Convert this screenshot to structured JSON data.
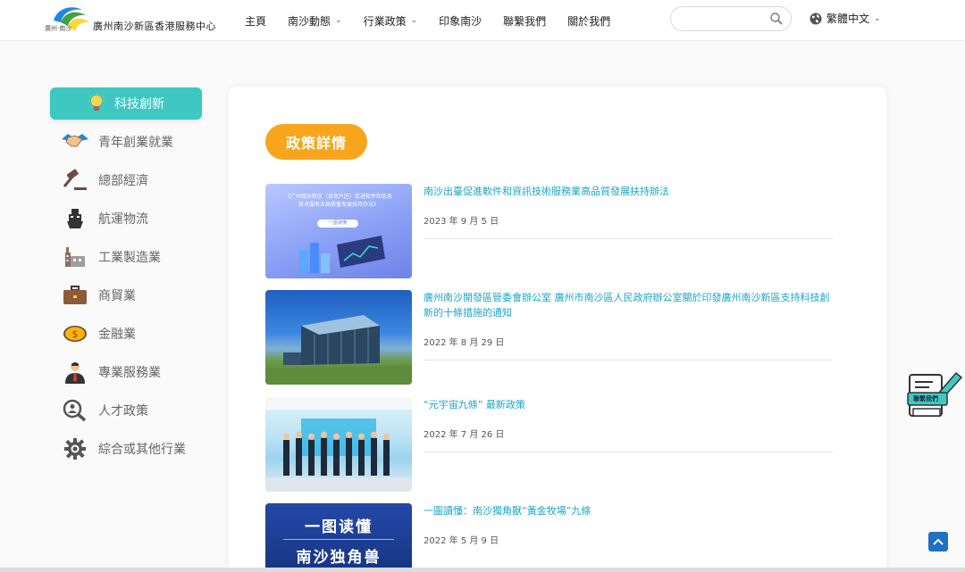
{
  "header": {
    "logo_small": "廣州·南沙",
    "logo_text": "廣州南沙新區香港服務中心",
    "nav": [
      {
        "label": "主頁",
        "has_dropdown": false
      },
      {
        "label": "南沙動態",
        "has_dropdown": true
      },
      {
        "label": "行業政策",
        "has_dropdown": true
      },
      {
        "label": "印象南沙",
        "has_dropdown": false
      },
      {
        "label": "聯繫我們",
        "has_dropdown": false
      },
      {
        "label": "關於我們",
        "has_dropdown": false
      }
    ],
    "search": {
      "value": "",
      "placeholder": ""
    },
    "language": "繁體中文"
  },
  "sidebar": {
    "items": [
      {
        "label": "科技創新",
        "icon": "lightbulb-icon",
        "active": true
      },
      {
        "label": "青年創業就業",
        "icon": "handshake-icon",
        "active": false
      },
      {
        "label": "總部經濟",
        "icon": "gavel-icon",
        "active": false
      },
      {
        "label": "航運物流",
        "icon": "ship-icon",
        "active": false
      },
      {
        "label": "工業製造業",
        "icon": "factory-icon",
        "active": false
      },
      {
        "label": "商貿業",
        "icon": "briefcase-icon",
        "active": false
      },
      {
        "label": "金融業",
        "icon": "coin-icon",
        "active": false
      },
      {
        "label": "專業服務業",
        "icon": "businessman-icon",
        "active": false
      },
      {
        "label": "人才政策",
        "icon": "magnifier-person-icon",
        "active": false
      },
      {
        "label": "綜合或其他行業",
        "icon": "gear-icon",
        "active": false
      }
    ]
  },
  "main": {
    "section_label": "政策詳情",
    "posts": [
      {
        "title": "南沙出臺促進軟件和資訊技術服務業高品質發展扶持辦法",
        "date": "2023 年 9 月 5 日",
        "thumb_text": "《广州南沙新区（自贸片区）促进软件和信息技术服务业高质量发展扶持办法》",
        "thumb_badge": "一图读懂"
      },
      {
        "title": "廣州南沙開發區管委會辦公室 廣州市南沙區人民政府辦公室關於印發廣州南沙新區支持科技創新的十條措施的通知",
        "date": "2022 年 8 月 29 日"
      },
      {
        "title": "“元宇宙九條” 最新政策",
        "date": "2022 年 7 月 26 日"
      },
      {
        "title": "一圖讀懂：南沙獨角獸“黃金牧場”九條",
        "date": "2022 年 5 月 9 日",
        "thumb_line1": "一图读懂",
        "thumb_line2": "南沙独角兽"
      }
    ]
  },
  "floating": {
    "contact_label": "聯繫我們"
  },
  "colors": {
    "accent_teal": "#3ec8c1",
    "pill_orange": "#f7a51c",
    "link_blue": "#1aa6c8",
    "top_button": "#1f6fc4"
  }
}
